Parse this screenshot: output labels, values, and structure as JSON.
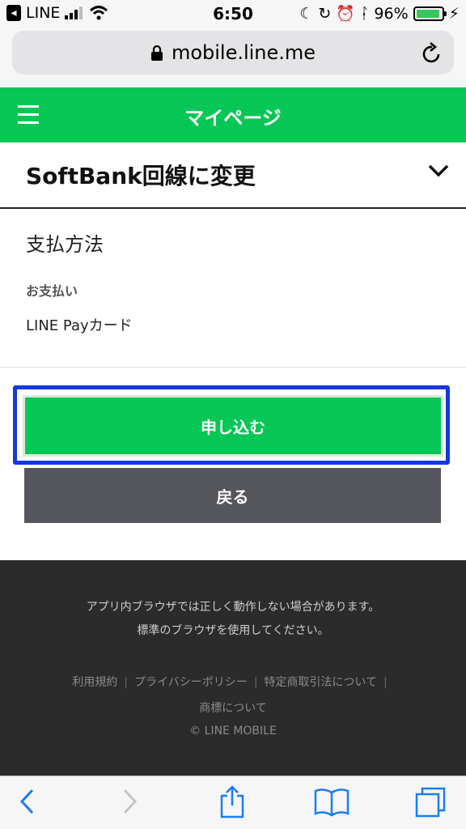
{
  "status_bar": {
    "back_app_label": "LINE",
    "time": "6:50",
    "battery_percent": "96%",
    "battery_level": 0.96
  },
  "url_bar": {
    "url": "mobile.line.me"
  },
  "header": {
    "title": "マイページ"
  },
  "plan": {
    "title": "SoftBank回線に変更"
  },
  "payment": {
    "heading": "支払方法",
    "label": "お支払い",
    "value": "LINE Payカード"
  },
  "actions": {
    "apply_label": "申し込む",
    "back_label": "戻る"
  },
  "footer": {
    "notice_line1": "アプリ内ブラウザでは正しく動作しない場合があります。",
    "notice_line2": "標準のブラウザを使用してください。",
    "links": [
      "利用規約",
      "プライバシーポリシー",
      "特定商取引法について"
    ],
    "trademark": "商標について",
    "copyright": "© LINE MOBILE"
  },
  "colors": {
    "brand_green": "#06c755",
    "highlight_blue": "#1438e0",
    "dark_button": "#55555c",
    "footer_bg": "#2b2b2b"
  }
}
